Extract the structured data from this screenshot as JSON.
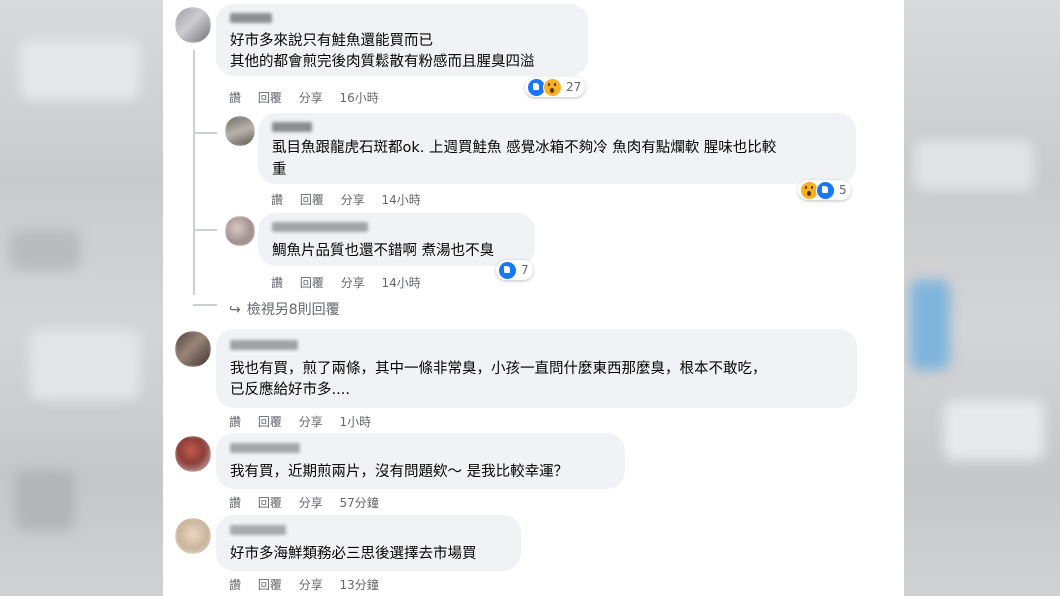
{
  "comments": [
    {
      "text_lines": [
        "好市多來說只有鮭魚還能買而已",
        "其他的都會煎完後肉質鬆散有粉感而且腥臭四溢"
      ],
      "actions": {
        "like": "讚",
        "reply": "回覆",
        "share": "分享",
        "time": "16小時"
      },
      "reaction_count": "27"
    },
    {
      "text_lines": [
        "虱目魚跟龍虎石斑都ok. 上週買鮭魚 感覺冰箱不夠冷 魚肉有點爛軟 腥味也比較",
        "重"
      ],
      "actions": {
        "like": "讚",
        "reply": "回覆",
        "share": "分享",
        "time": "14小時"
      },
      "reaction_count": "5"
    },
    {
      "text_lines": [
        "鯛魚片品質也還不錯啊 煮湯也不臭"
      ],
      "actions": {
        "like": "讚",
        "reply": "回覆",
        "share": "分享",
        "time": "14小時"
      },
      "reaction_count": "7"
    },
    {
      "text_lines": [
        "我也有買，煎了兩條，其中一條非常臭，小孩一直問什麼東西那麼臭，根本不敢吃，",
        "已反應給好市多...."
      ],
      "actions": {
        "like": "讚",
        "reply": "回覆",
        "share": "分享",
        "time": "1小時"
      }
    },
    {
      "text_lines": [
        "我有買，近期煎兩片，沒有問題欸～ 是我比較幸運？"
      ],
      "actions": {
        "like": "讚",
        "reply": "回覆",
        "share": "分享",
        "time": "57分鐘"
      }
    },
    {
      "text_lines": [
        "好市多海鮮類務必三思後選擇去市場買"
      ],
      "actions": {
        "like": "讚",
        "reply": "回覆",
        "share": "分享",
        "time": "13分鐘"
      }
    }
  ],
  "view_more_replies": {
    "arrow": "↪",
    "label": "檢視另8則回覆"
  },
  "colors": {
    "bubble": "#f0f2f5",
    "meta_text": "#65676b",
    "body_text": "#050505",
    "like_blue": "#1877f2",
    "wow_yellow": "#f7b125"
  },
  "icons": {
    "like_reaction": "like-icon",
    "wow_reaction": "wow-icon",
    "reply_arrow": "reply-arrow-icon"
  }
}
